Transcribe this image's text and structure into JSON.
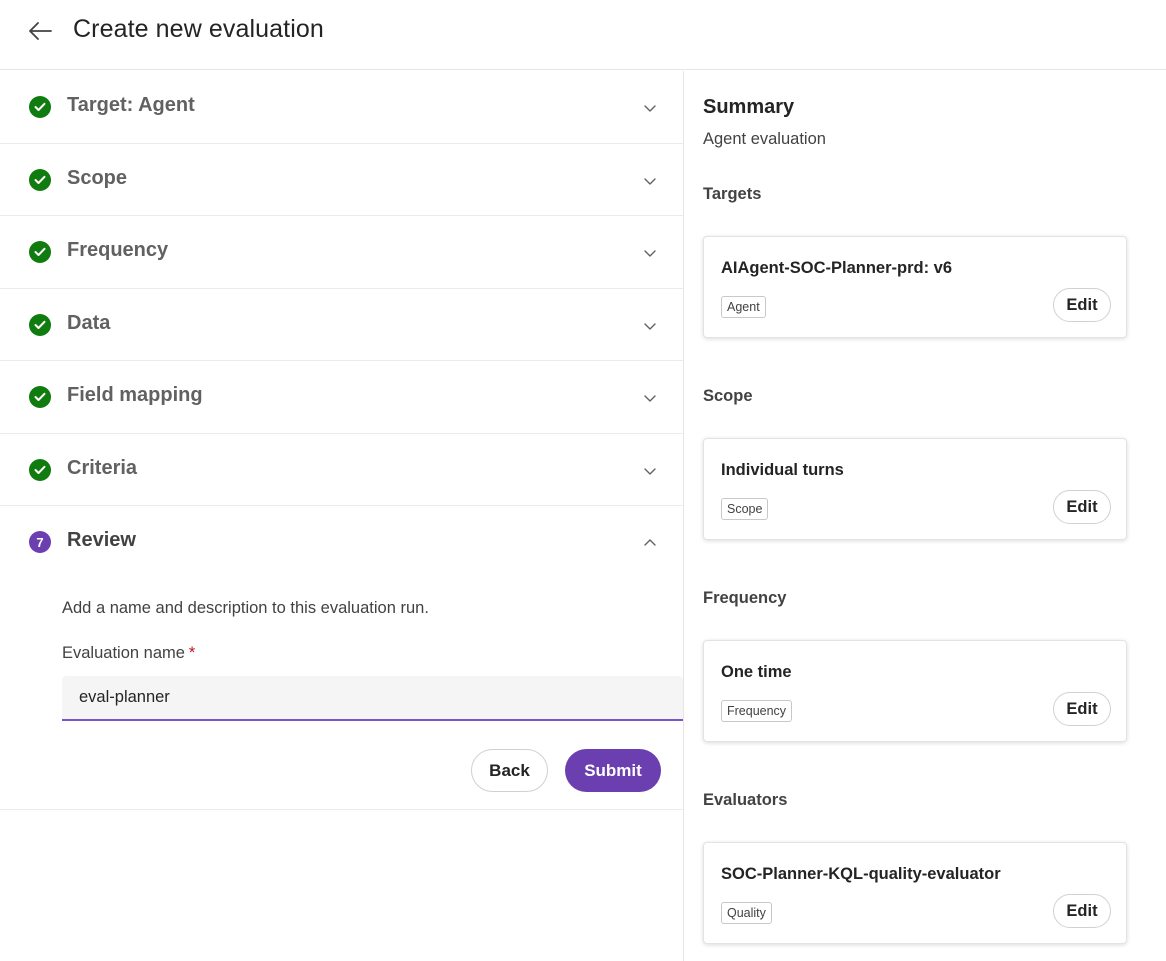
{
  "header": {
    "title": "Create new evaluation"
  },
  "steps": [
    {
      "label": "Target: Agent",
      "status": "complete"
    },
    {
      "label": "Scope",
      "status": "complete"
    },
    {
      "label": "Frequency",
      "status": "complete"
    },
    {
      "label": "Data",
      "status": "complete"
    },
    {
      "label": "Field mapping",
      "status": "complete"
    },
    {
      "label": "Criteria",
      "status": "complete"
    }
  ],
  "review": {
    "number": "7",
    "label": "Review",
    "description": "Add a name and description to this evaluation run.",
    "name_label": "Evaluation name",
    "required_mark": "*",
    "name_value": "eval-planner",
    "back_label": "Back",
    "submit_label": "Submit"
  },
  "summary": {
    "title": "Summary",
    "subtitle": "Agent evaluation",
    "sections": [
      {
        "label": "Targets",
        "card_title": "AIAgent-SOC-Planner-prd: v6",
        "tag": "Agent",
        "edit_label": "Edit"
      },
      {
        "label": "Scope",
        "card_title": "Individual turns",
        "tag": "Scope",
        "edit_label": "Edit"
      },
      {
        "label": "Frequency",
        "card_title": "One time",
        "tag": "Frequency",
        "edit_label": "Edit"
      },
      {
        "label": "Evaluators",
        "card_title": "SOC-Planner-KQL-quality-evaluator",
        "tag": "Quality",
        "edit_label": "Edit"
      }
    ]
  },
  "colors": {
    "accent": "#6b3fb0",
    "success": "#107c10",
    "required": "#c50f1f"
  }
}
